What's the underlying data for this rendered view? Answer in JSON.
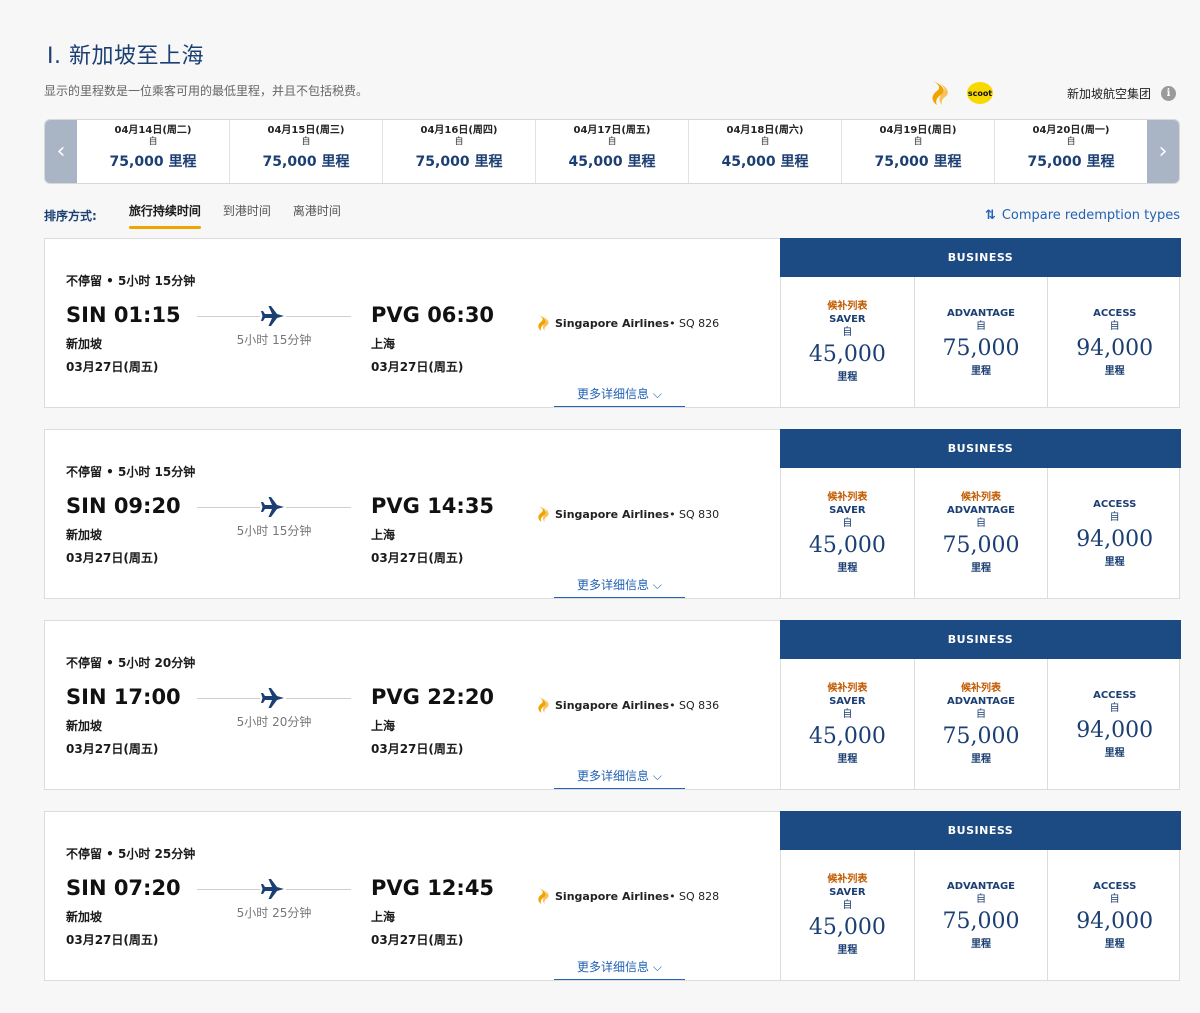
{
  "page": {
    "title": "I. 新加坡至上海",
    "subtitle": "显示的里程数是一位乘客可用的最低里程，并且不包括税费。",
    "group_label": "新加坡航空集团",
    "scoot_text": "scoot",
    "info_icon": "i"
  },
  "date_strip": {
    "prev_icon": "‹",
    "next_icon": "›",
    "dates": [
      {
        "date": "04月14日(周二)",
        "from": "自",
        "miles": "75,000 里程"
      },
      {
        "date": "04月15日(周三)",
        "from": "自",
        "miles": "75,000 里程"
      },
      {
        "date": "04月16日(周四)",
        "from": "自",
        "miles": "75,000 里程"
      },
      {
        "date": "04月17日(周五)",
        "from": "自",
        "miles": "45,000 里程"
      },
      {
        "date": "04月18日(周六)",
        "from": "自",
        "miles": "45,000 里程"
      },
      {
        "date": "04月19日(周日)",
        "from": "自",
        "miles": "75,000 里程"
      },
      {
        "date": "04月20日(周一)",
        "from": "自",
        "miles": "75,000 里程"
      }
    ]
  },
  "sort": {
    "label": "排序方式:",
    "options": [
      "旅行持续时间",
      "到港时间",
      "离港时间"
    ],
    "active": 0,
    "compare_label": "Compare redemption types",
    "compare_icon": "⇅"
  },
  "flights": [
    {
      "stop_info": "不停留 • 5小时 15分钟",
      "dep_time": "SIN 01:15",
      "dep_city": "新加坡",
      "dep_date": "03月27日(周五)",
      "arr_time": "PVG 06:30",
      "arr_city": "上海",
      "arr_date": "03月27日(周五)",
      "duration": "5小时 15分钟",
      "airline": "Singapore Airlines",
      "flight_no": " • SQ 826",
      "details": "更多详细信息 ⌵",
      "cabin": "BUSINESS",
      "fares": [
        {
          "waitlist": "候补列表",
          "type": "SAVER",
          "from": "自",
          "amount": "45,000",
          "unit": "里程"
        },
        {
          "waitlist": "",
          "type": "ADVANTAGE",
          "from": "自",
          "amount": "75,000",
          "unit": "里程"
        },
        {
          "waitlist": "",
          "type": "ACCESS",
          "from": "自",
          "amount": "94,000",
          "unit": "里程"
        }
      ]
    },
    {
      "stop_info": "不停留 • 5小时 15分钟",
      "dep_time": "SIN 09:20",
      "dep_city": "新加坡",
      "dep_date": "03月27日(周五)",
      "arr_time": "PVG 14:35",
      "arr_city": "上海",
      "arr_date": "03月27日(周五)",
      "duration": "5小时 15分钟",
      "airline": "Singapore Airlines",
      "flight_no": " • SQ 830",
      "details": "更多详细信息 ⌵",
      "cabin": "BUSINESS",
      "fares": [
        {
          "waitlist": "候补列表",
          "type": "SAVER",
          "from": "自",
          "amount": "45,000",
          "unit": "里程"
        },
        {
          "waitlist": "候补列表",
          "type": "ADVANTAGE",
          "from": "自",
          "amount": "75,000",
          "unit": "里程"
        },
        {
          "waitlist": "",
          "type": "ACCESS",
          "from": "自",
          "amount": "94,000",
          "unit": "里程"
        }
      ]
    },
    {
      "stop_info": "不停留 • 5小时 20分钟",
      "dep_time": "SIN 17:00",
      "dep_city": "新加坡",
      "dep_date": "03月27日(周五)",
      "arr_time": "PVG 22:20",
      "arr_city": "上海",
      "arr_date": "03月27日(周五)",
      "duration": "5小时 20分钟",
      "airline": "Singapore Airlines",
      "flight_no": " • SQ 836",
      "details": "更多详细信息 ⌵",
      "cabin": "BUSINESS",
      "fares": [
        {
          "waitlist": "候补列表",
          "type": "SAVER",
          "from": "自",
          "amount": "45,000",
          "unit": "里程"
        },
        {
          "waitlist": "候补列表",
          "type": "ADVANTAGE",
          "from": "自",
          "amount": "75,000",
          "unit": "里程"
        },
        {
          "waitlist": "",
          "type": "ACCESS",
          "from": "自",
          "amount": "94,000",
          "unit": "里程"
        }
      ]
    },
    {
      "stop_info": "不停留 • 5小时 25分钟",
      "dep_time": "SIN 07:20",
      "dep_city": "新加坡",
      "dep_date": "03月27日(周五)",
      "arr_time": "PVG 12:45",
      "arr_city": "上海",
      "arr_date": "03月27日(周五)",
      "duration": "5小时 25分钟",
      "airline": "Singapore Airlines",
      "flight_no": " • SQ 828",
      "details": "更多详细信息 ⌵",
      "cabin": "BUSINESS",
      "fares": [
        {
          "waitlist": "候补列表",
          "type": "SAVER",
          "from": "自",
          "amount": "45,000",
          "unit": "里程"
        },
        {
          "waitlist": "",
          "type": "ADVANTAGE",
          "from": "自",
          "amount": "75,000",
          "unit": "里程"
        },
        {
          "waitlist": "",
          "type": "ACCESS",
          "from": "自",
          "amount": "94,000",
          "unit": "里程"
        }
      ]
    }
  ],
  "colors": {
    "navy": "#1c3f73",
    "cabin_header": "#1c4a82",
    "waitlist": "#c25a00",
    "accent": "#f0a400",
    "link": "#2362b5"
  }
}
